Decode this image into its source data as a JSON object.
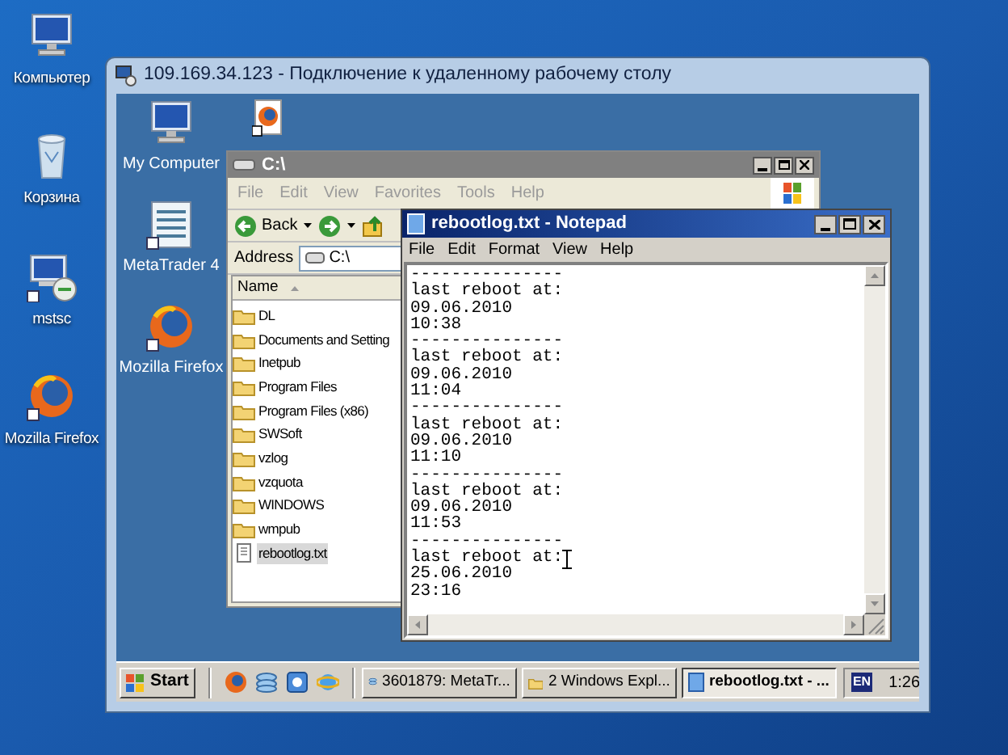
{
  "host_desktop": {
    "icons": [
      {
        "label": "Компьютер",
        "kind": "computer"
      },
      {
        "label": "Корзина",
        "kind": "bin"
      },
      {
        "label": "mstsc",
        "kind": "remote"
      },
      {
        "label": "Mozilla Firefox",
        "kind": "browser"
      }
    ]
  },
  "rdp_window": {
    "title": "109.169.34.123 - Подключение к удаленному рабочему столу"
  },
  "remote_desktop": {
    "icons": [
      {
        "label": "My Computer",
        "kind": "computer"
      },
      {
        "label": "MetaTrader 4",
        "kind": "chart"
      },
      {
        "label": "Mozilla Firefox",
        "kind": "browser"
      }
    ]
  },
  "explorer": {
    "title": "C:\\",
    "active": false,
    "menu": [
      "File",
      "Edit",
      "View",
      "Favorites",
      "Tools",
      "Help"
    ],
    "back": "Back",
    "address_label": "Address",
    "address": "C:\\",
    "column": "Name",
    "items": [
      {
        "name": "DL",
        "kind": "folder",
        "selected": false
      },
      {
        "name": "Documents and Setting",
        "kind": "folder",
        "selected": false
      },
      {
        "name": "Inetpub",
        "kind": "folder",
        "selected": false
      },
      {
        "name": "Program Files",
        "kind": "folder",
        "selected": false
      },
      {
        "name": "Program Files (x86)",
        "kind": "folder",
        "selected": false
      },
      {
        "name": "SWSoft",
        "kind": "folder",
        "selected": false
      },
      {
        "name": "vzlog",
        "kind": "folder",
        "selected": false
      },
      {
        "name": "vzquota",
        "kind": "folder",
        "selected": false
      },
      {
        "name": "WINDOWS",
        "kind": "folder",
        "selected": false
      },
      {
        "name": "wmpub",
        "kind": "folder",
        "selected": false
      },
      {
        "name": "rebootlog.txt",
        "kind": "file",
        "selected": true
      }
    ]
  },
  "notepad": {
    "title": "rebootlog.txt - Notepad",
    "active": true,
    "menu": [
      "File",
      "Edit",
      "Format",
      "View",
      "Help"
    ],
    "lines": [
      "---------------",
      "last reboot at:",
      "09.06.2010",
      "10:38",
      "---------------",
      "last reboot at:",
      "09.06.2010",
      "11:04",
      "---------------",
      "last reboot at:",
      "09.06.2010",
      "11:10",
      "---------------",
      "last reboot at:",
      "09.06.2010",
      "11:53",
      "---------------",
      "last reboot at:",
      "25.06.2010",
      "23:16"
    ]
  },
  "taskbar": {
    "start": "Start",
    "tasks": [
      {
        "label": "3601879: MetaTr...",
        "kind": "app",
        "selected": false
      },
      {
        "label": "2 Windows Expl...",
        "kind": "folder",
        "selected": false
      },
      {
        "label": "rebootlog.txt - ...",
        "kind": "notepad",
        "selected": true
      }
    ],
    "language": "EN",
    "clock": "1:26"
  }
}
